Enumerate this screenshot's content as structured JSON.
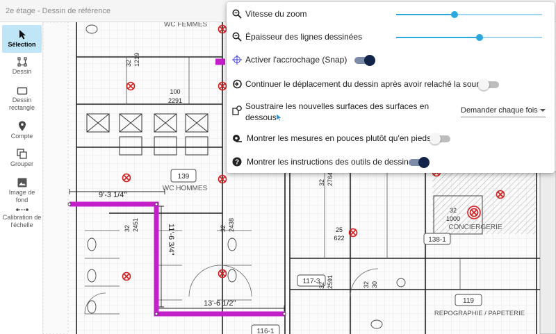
{
  "window": {
    "title": "2e étage - Dessin de référence"
  },
  "toolbar": {
    "items": [
      {
        "label": "Sélection",
        "icon": "cursor-icon",
        "active": true
      },
      {
        "label": "Dessin",
        "icon": "polyline-icon"
      },
      {
        "label": "Dessin rectangle",
        "icon": "rectangle-icon"
      },
      {
        "label": "Compte",
        "icon": "map-pin-icon"
      },
      {
        "label": "Grouper",
        "icon": "group-icon"
      },
      {
        "label": "Image de fond",
        "icon": "image-icon"
      },
      {
        "label": "Calibration de l'échelle",
        "icon": "scale-calibration-icon"
      }
    ]
  },
  "settings": {
    "zoom_speed": {
      "label": "Vitesse du zoom",
      "value_fraction": 0.4
    },
    "line_thickness": {
      "label": "Épaisseur des lignes dessinées",
      "value_fraction": 0.57
    },
    "snap": {
      "label": "Activer l'accrochage (Snap)",
      "on": true
    },
    "continue_drag": {
      "label": "Continuer le déplacement du dessin après avoir relaché la souris",
      "on": false
    },
    "subtract": {
      "label_line1": "Soustraire les nouvelles surfaces des surfaces en",
      "label_line2": "dessous",
      "select_value": "Demander chaque fois"
    },
    "inches": {
      "label": "Montrer les mesures en pouces plutôt qu'en pieds",
      "on": false
    },
    "instructions": {
      "label": "Montrer les instructions des outils de dessin",
      "on": true
    }
  },
  "drawing": {
    "measurements": [
      "9'-3 1/4\"",
      "11'-6 3/4\"",
      "13'-6 1/2\""
    ],
    "room_labels": [
      "WC FEMMES",
      "WC HOMMES",
      "CONCIERGERIE",
      "REPOGRAPHIE / PAPETERIE"
    ],
    "room_numbers": [
      "139",
      "138-1",
      "117-3",
      "116-1",
      "119"
    ],
    "dimension_labels": [
      "100",
      "2291",
      "32",
      "1219",
      "32",
      "2451",
      "32",
      "2438",
      "25",
      "622",
      "32",
      "1000",
      "32",
      "2764",
      "32",
      "2591",
      "32",
      "30"
    ],
    "accent_colors": {
      "wall": "#c21fc9",
      "active_tool": "#bfe6f7",
      "slider": "#2aa7dc",
      "toggle_on": "#12244a"
    }
  }
}
